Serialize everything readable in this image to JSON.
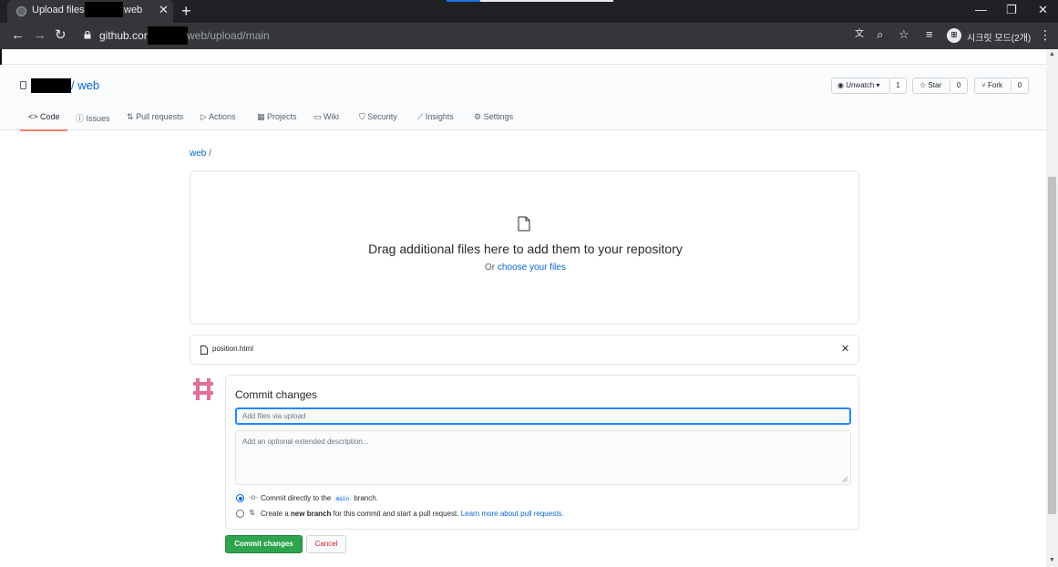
{
  "browser": {
    "tab": {
      "title_prefix": "Upload files",
      "title_suffix": "web",
      "close": "✕"
    },
    "new_tab": "+",
    "window": {
      "minimize": "—",
      "restore": "❐",
      "close": "✕"
    },
    "nav": {
      "back": "←",
      "forward": "→",
      "reload": "↻"
    },
    "url": {
      "domain": "github.com",
      "path": "web/upload/main"
    },
    "profile": {
      "avatar": "ꕥ",
      "label": "시크릿 모드(2개)"
    },
    "menu": "⋮",
    "icons": {
      "translate": "文",
      "zoom": "⌕",
      "star": "☆",
      "reading_list": "≡"
    }
  },
  "repo": {
    "name": "/ web",
    "watch": {
      "label": "Unwatch",
      "count": "1"
    },
    "star": {
      "label": "Star",
      "count": "0"
    },
    "fork": {
      "label": "Fork",
      "count": "0"
    },
    "nav": [
      {
        "label": "Code",
        "icon": "<>"
      },
      {
        "label": "Issues",
        "icon": "ⓘ"
      },
      {
        "label": "Pull requests",
        "icon": "⇅"
      },
      {
        "label": "Actions",
        "icon": "▷"
      },
      {
        "label": "Projects",
        "icon": "▦"
      },
      {
        "label": "Wiki",
        "icon": "▭"
      },
      {
        "label": "Security",
        "icon": "⛉"
      },
      {
        "label": "Insights",
        "icon": "⟋"
      },
      {
        "label": "Settings",
        "icon": "⚙"
      }
    ]
  },
  "breadcrumb": {
    "repo": "web",
    "sep": "/"
  },
  "dropzone": {
    "title": "Drag additional files here to add them to your repository",
    "or_text": "Or",
    "choose_link": "choose your files"
  },
  "uploaded_file": {
    "name": "position.html",
    "remove": "✕"
  },
  "commit": {
    "title": "Commit changes",
    "summary_placeholder": "Add files via upload",
    "description_placeholder": "Add an optional extended description...",
    "option_direct": {
      "prefix": "Commit directly to the",
      "branch": "main",
      "suffix": "branch."
    },
    "option_new": {
      "prefix": "Create a",
      "bold": "new branch",
      "middle": "for this commit and start a pull request.",
      "link": "Learn more about pull requests."
    },
    "submit": "Commit changes",
    "cancel": "Cancel"
  },
  "colors": {
    "link": "#0366d6",
    "primary": "#2ea44f",
    "danger": "#cb2431",
    "tab_underline": "#f9826c"
  }
}
